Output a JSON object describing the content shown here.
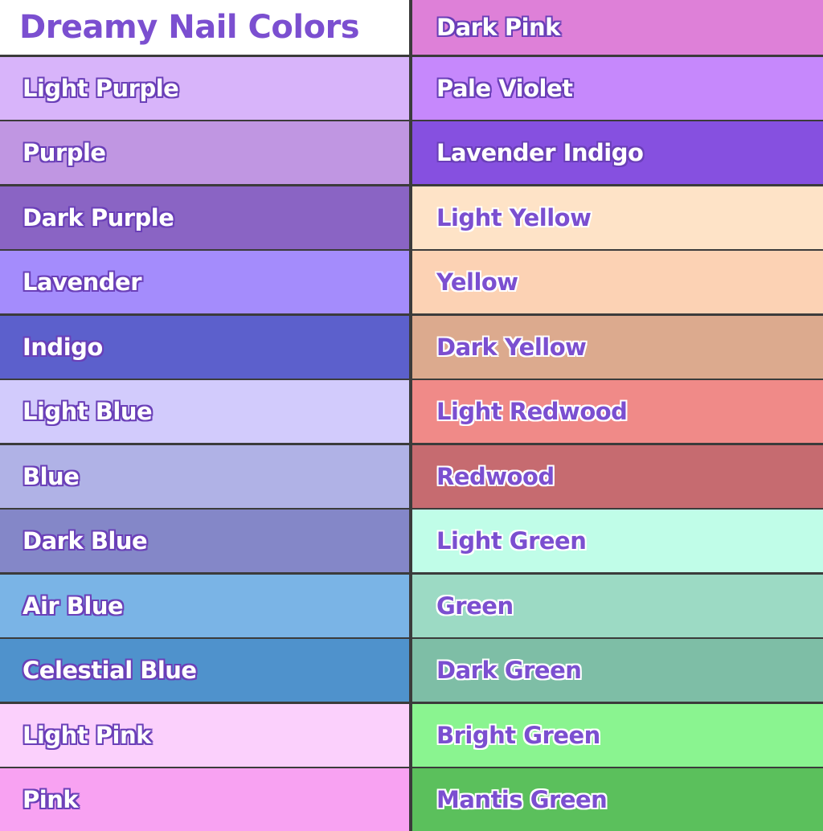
{
  "title": "Dreamy Nail Colors",
  "left_column": [
    {
      "label": "Light Purple",
      "color": "#d8b4fa",
      "text_style": "light"
    },
    {
      "label": "Purple",
      "color": "#c096e2",
      "text_style": "light"
    },
    {
      "label": "Dark Purple",
      "color": "#8a64c4",
      "text_style": "light"
    },
    {
      "label": "Lavender",
      "color": "#a48cfc",
      "text_style": "light"
    },
    {
      "label": "Indigo",
      "color": "#5c60cc",
      "text_style": "light"
    },
    {
      "label": "Light Blue",
      "color": "#d2cbfc",
      "text_style": "light"
    },
    {
      "label": "Blue",
      "color": "#b0b2e6",
      "text_style": "light"
    },
    {
      "label": "Dark Blue",
      "color": "#8487c8",
      "text_style": "light"
    },
    {
      "label": "Air Blue",
      "color": "#7ab4e6",
      "text_style": "light"
    },
    {
      "label": "Celestial Blue",
      "color": "#4f92cc",
      "text_style": "light"
    },
    {
      "label": "Light Pink",
      "color": "#fbd0fc",
      "text_style": "light"
    },
    {
      "label": "Pink",
      "color": "#f8a2f2",
      "text_style": "light"
    }
  ],
  "right_column": [
    {
      "label": "Dark Pink",
      "color": "#de80d8",
      "text_style": "light"
    },
    {
      "label": "Pale Violet",
      "color": "#c688fc",
      "text_style": "light"
    },
    {
      "label": "Lavender Indigo",
      "color": "#8650e0",
      "text_style": "light"
    },
    {
      "label": "Light Yellow",
      "color": "#fee3c7",
      "text_style": "dark"
    },
    {
      "label": "Yellow",
      "color": "#fcd2b4",
      "text_style": "dark"
    },
    {
      "label": "Dark Yellow",
      "color": "#dcaa8e",
      "text_style": "dark"
    },
    {
      "label": "Light Redwood",
      "color": "#f08a88",
      "text_style": "dark"
    },
    {
      "label": "Redwood",
      "color": "#c66b70",
      "text_style": "dark"
    },
    {
      "label": "Light Green",
      "color": "#c0fde8",
      "text_style": "dark"
    },
    {
      "label": "Green",
      "color": "#9cdac4",
      "text_style": "dark"
    },
    {
      "label": "Dark Green",
      "color": "#7ebea6",
      "text_style": "dark"
    },
    {
      "label": "Bright Green",
      "color": "#8af490",
      "text_style": "dark"
    },
    {
      "label": "Mantis Green",
      "color": "#5bc05c",
      "text_style": "dark"
    }
  ]
}
